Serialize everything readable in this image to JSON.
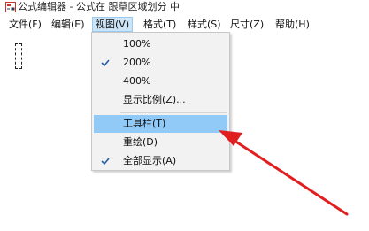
{
  "window": {
    "title": "公式编辑器 - 公式在 跟草区域划分 中"
  },
  "menubar": {
    "items": [
      {
        "label": "文件(F)"
      },
      {
        "label": "编辑(E)"
      },
      {
        "label": "视图(V)"
      },
      {
        "label": "格式(T)"
      },
      {
        "label": "样式(S)"
      },
      {
        "label": "尺寸(Z)"
      },
      {
        "label": "帮助(H)"
      }
    ],
    "active_index": 2
  },
  "view_menu": {
    "items": [
      {
        "label": "100%",
        "checked": false
      },
      {
        "label": "200%",
        "checked": true
      },
      {
        "label": "400%",
        "checked": false
      },
      {
        "label": "显示比例(Z)...",
        "checked": false
      },
      {
        "label": "工具栏(T)",
        "checked": false,
        "highlighted": true
      },
      {
        "label": "重绘(D)",
        "checked": false
      },
      {
        "label": "全部显示(A)",
        "checked": true
      }
    ]
  },
  "colors": {
    "highlight": "#91c9f7",
    "menu_active": "#cce4f7",
    "annotation_arrow": "#e02020"
  }
}
